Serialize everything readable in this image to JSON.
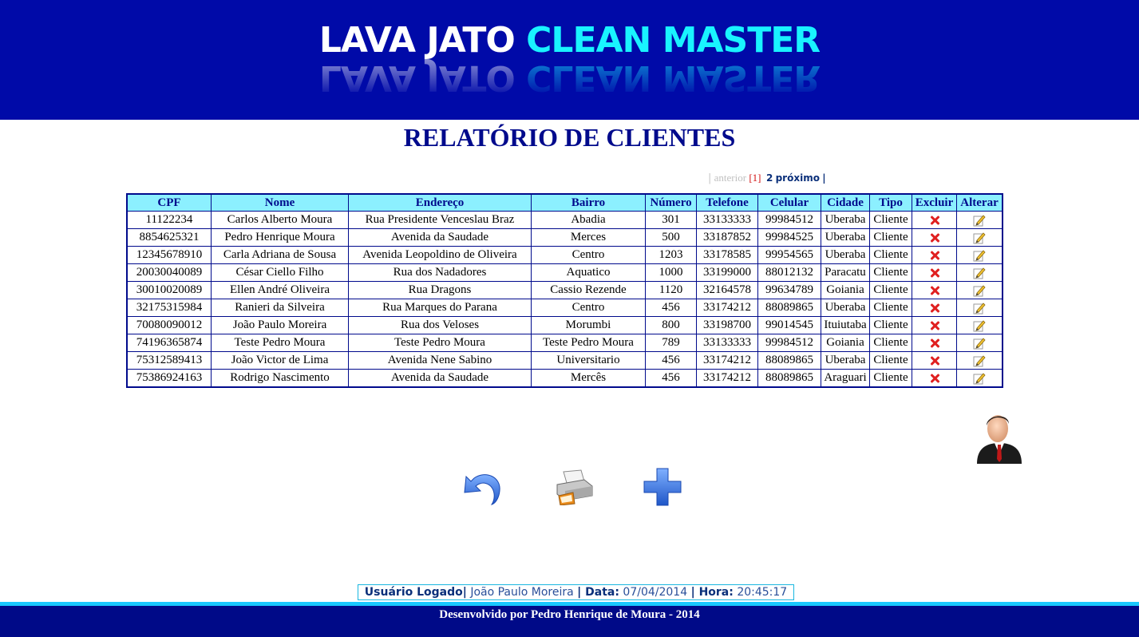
{
  "header": {
    "logo_white": "LAVA JATO ",
    "logo_cyan": "CLEAN MASTER"
  },
  "page_title": "RELATÓRIO DE CLIENTES",
  "pager": {
    "sep": "|",
    "prev": "anterior",
    "current": "[1]",
    "page2": "2",
    "next": "próximo",
    "sep_end": "|"
  },
  "table": {
    "columns": [
      "CPF",
      "Nome",
      "Endereço",
      "Bairro",
      "Número",
      "Telefone",
      "Celular",
      "Cidade",
      "Tipo",
      "Excluir",
      "Alterar"
    ],
    "rows": [
      [
        "11122234",
        "Carlos Alberto Moura",
        "Rua Presidente Venceslau Braz",
        "Abadia",
        "301",
        "33133333",
        "99984512",
        "Uberaba",
        "Cliente"
      ],
      [
        "8854625321",
        "Pedro Henrique Moura",
        "Avenida da Saudade",
        "Merces",
        "500",
        "33187852",
        "99984525",
        "Uberaba",
        "Cliente"
      ],
      [
        "12345678910",
        "Carla Adriana de Sousa",
        "Avenida Leopoldino de Oliveira",
        "Centro",
        "1203",
        "33178585",
        "99954565",
        "Uberaba",
        "Cliente"
      ],
      [
        "20030040089",
        "César Ciello Filho",
        "Rua dos Nadadores",
        "Aquatico",
        "1000",
        "33199000",
        "88012132",
        "Paracatu",
        "Cliente"
      ],
      [
        "30010020089",
        "Ellen André Oliveira",
        "Rua Dragons",
        "Cassio Rezende",
        "1120",
        "32164578",
        "99634789",
        "Goiania",
        "Cliente"
      ],
      [
        "32175315984",
        "Ranieri da Silveira",
        "Rua Marques do Parana",
        "Centro",
        "456",
        "33174212",
        "88089865",
        "Uberaba",
        "Cliente"
      ],
      [
        "70080090012",
        "João Paulo Moreira",
        "Rua dos Veloses",
        "Morumbi",
        "800",
        "33198700",
        "99014545",
        "Ituiutaba",
        "Cliente"
      ],
      [
        "74196365874",
        "Teste Pedro Moura",
        "Teste Pedro Moura",
        "Teste Pedro Moura",
        "789",
        "33133333",
        "99984512",
        "Goiania",
        "Cliente"
      ],
      [
        "75312589413",
        "João Victor de Lima",
        "Avenida Nene Sabino",
        "Universitario",
        "456",
        "33174212",
        "88089865",
        "Uberaba",
        "Cliente"
      ],
      [
        "75386924163",
        "Rodrigo Nascimento",
        "Avenida da Saudade",
        "Mercês",
        "456",
        "33174212",
        "88089865",
        "Araguari",
        "Cliente"
      ]
    ]
  },
  "icons": {
    "back": "undo-arrow-icon",
    "print": "printer-icon",
    "add": "plus-icon",
    "user": "user-avatar-icon",
    "delete": "delete-x-icon",
    "edit": "pencil-edit-icon"
  },
  "userbar": {
    "user_label": "Usuário Logado|",
    "user_value": "João Paulo Moreira",
    "date_label": "| Data:",
    "date_value": "07/04/2014",
    "time_label": "| Hora:",
    "time_value": "20:45:17"
  },
  "footer": {
    "text": "Desenvolvido por Pedro Henrique de Moura - 2014"
  },
  "colors": {
    "header_bg": "#000aa8",
    "logo_cyan": "#19f3ff",
    "title": "#000a8c",
    "table_header_bg": "#8cf0ff",
    "footer_bg": "#000a88",
    "footer_line": "#19c8ff"
  }
}
